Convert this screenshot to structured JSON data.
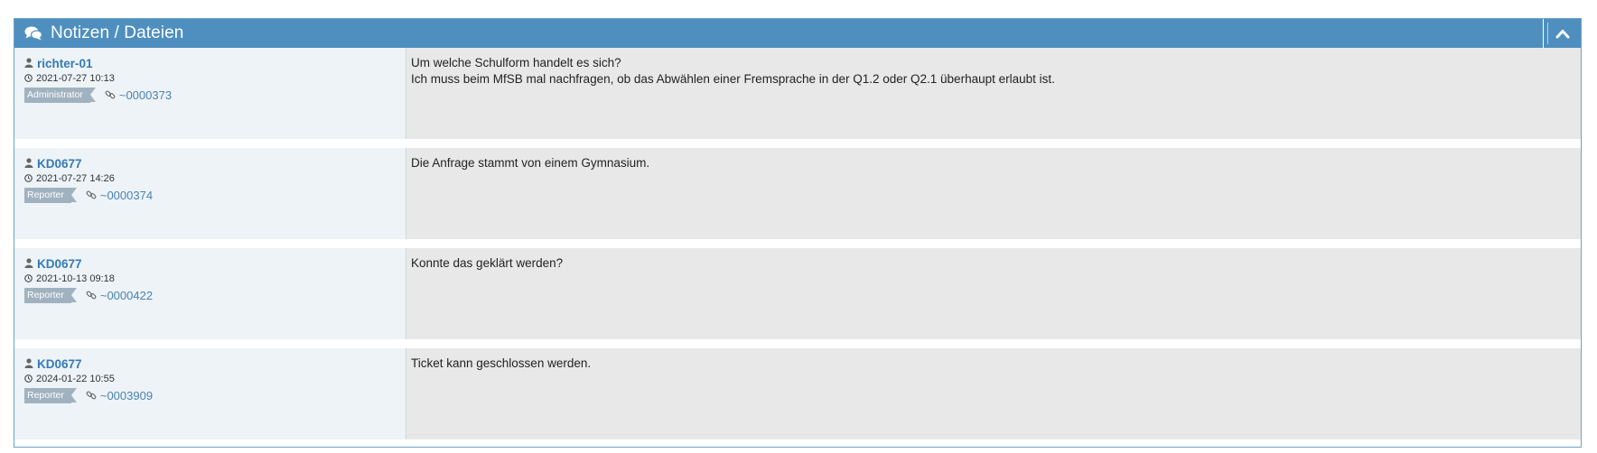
{
  "panel": {
    "title": "Notizen / Dateien",
    "header_icon": "comments-icon",
    "collapse_icon": "chevron-up-icon",
    "accent_color": "#4e8fc0"
  },
  "notes": [
    {
      "author": "richter-01",
      "date": "2021-07-27 10:13",
      "role": "Administrator",
      "link": "~0000373",
      "lines": [
        "Um welche Schulform handelt es sich?",
        "Ich muss beim MfSB mal nachfragen, ob das Abwählen einer Fremsprache in der Q1.2 oder Q2.1 überhaupt erlaubt ist."
      ]
    },
    {
      "author": "KD0677",
      "date": "2021-07-27 14:26",
      "role": "Reporter",
      "link": "~0000374",
      "lines": [
        "Die Anfrage stammt von einem Gymnasium."
      ]
    },
    {
      "author": "KD0677",
      "date": "2021-10-13 09:18",
      "role": "Reporter",
      "link": "~0000422",
      "lines": [
        "Konnte das geklärt werden?"
      ]
    },
    {
      "author": "KD0677",
      "date": "2024-01-22 10:55",
      "role": "Reporter",
      "link": "~0003909",
      "lines": [
        "Ticket kann geschlossen werden."
      ]
    }
  ]
}
